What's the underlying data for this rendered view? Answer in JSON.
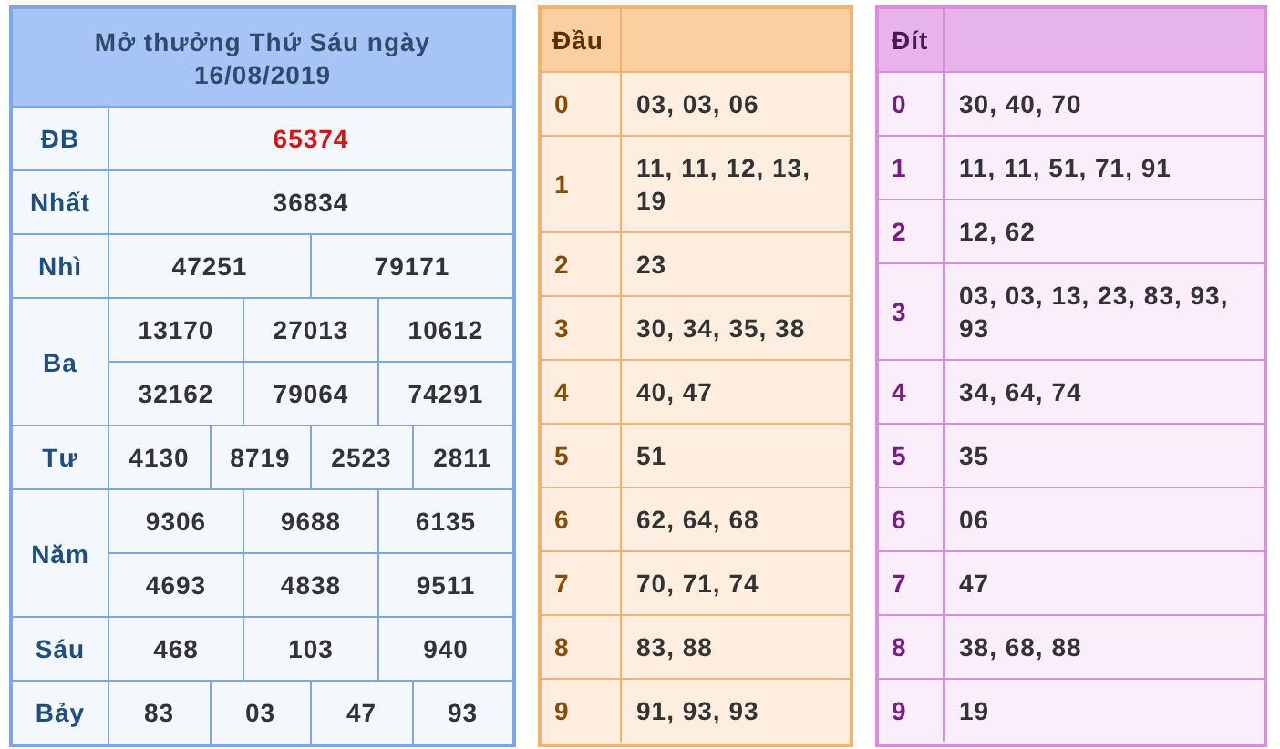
{
  "results": {
    "title": "Mở thưởng Thứ Sáu ngày",
    "date": "16/08/2019",
    "prizes": [
      {
        "label": "ĐB",
        "kind": "special",
        "rows": [
          [
            "65374"
          ]
        ]
      },
      {
        "label": "Nhất",
        "kind": "normal",
        "rows": [
          [
            "36834"
          ]
        ]
      },
      {
        "label": "Nhì",
        "kind": "normal",
        "rows": [
          [
            "47251",
            "79171"
          ]
        ]
      },
      {
        "label": "Ba",
        "kind": "normal",
        "rows": [
          [
            "13170",
            "27013",
            "10612"
          ],
          [
            "32162",
            "79064",
            "74291"
          ]
        ]
      },
      {
        "label": "Tư",
        "kind": "normal",
        "rows": [
          [
            "4130",
            "8719",
            "2523",
            "2811"
          ]
        ]
      },
      {
        "label": "Năm",
        "kind": "normal",
        "rows": [
          [
            "9306",
            "9688",
            "6135"
          ],
          [
            "4693",
            "4838",
            "9511"
          ]
        ]
      },
      {
        "label": "Sáu",
        "kind": "normal",
        "rows": [
          [
            "468",
            "103",
            "940"
          ]
        ]
      },
      {
        "label": "Bảy",
        "kind": "normal",
        "rows": [
          [
            "83",
            "03",
            "47",
            "93"
          ]
        ]
      }
    ]
  },
  "tables": [
    {
      "kind": "head",
      "header": "Đầu",
      "rows": [
        {
          "digit": "0",
          "values": "03, 03, 06"
        },
        {
          "digit": "1",
          "values": "11, 11, 12, 13, 19"
        },
        {
          "digit": "2",
          "values": "23"
        },
        {
          "digit": "3",
          "values": "30, 34, 35, 38"
        },
        {
          "digit": "4",
          "values": "40, 47"
        },
        {
          "digit": "5",
          "values": "51"
        },
        {
          "digit": "6",
          "values": "62, 64, 68"
        },
        {
          "digit": "7",
          "values": "70, 71, 74"
        },
        {
          "digit": "8",
          "values": "83, 88"
        },
        {
          "digit": "9",
          "values": "91, 93, 93"
        }
      ]
    },
    {
      "kind": "tail",
      "header": "Đít",
      "rows": [
        {
          "digit": "0",
          "values": "30, 40, 70"
        },
        {
          "digit": "1",
          "values": "11, 11, 51, 71, 91"
        },
        {
          "digit": "2",
          "values": "12, 62"
        },
        {
          "digit": "3",
          "values": "03, 03, 13, 23, 83, 93, 93"
        },
        {
          "digit": "4",
          "values": "34, 64, 74"
        },
        {
          "digit": "5",
          "values": "35"
        },
        {
          "digit": "6",
          "values": "06"
        },
        {
          "digit": "7",
          "values": "47"
        },
        {
          "digit": "8",
          "values": "38, 68, 88"
        },
        {
          "digit": "9",
          "values": "19"
        }
      ]
    }
  ]
}
